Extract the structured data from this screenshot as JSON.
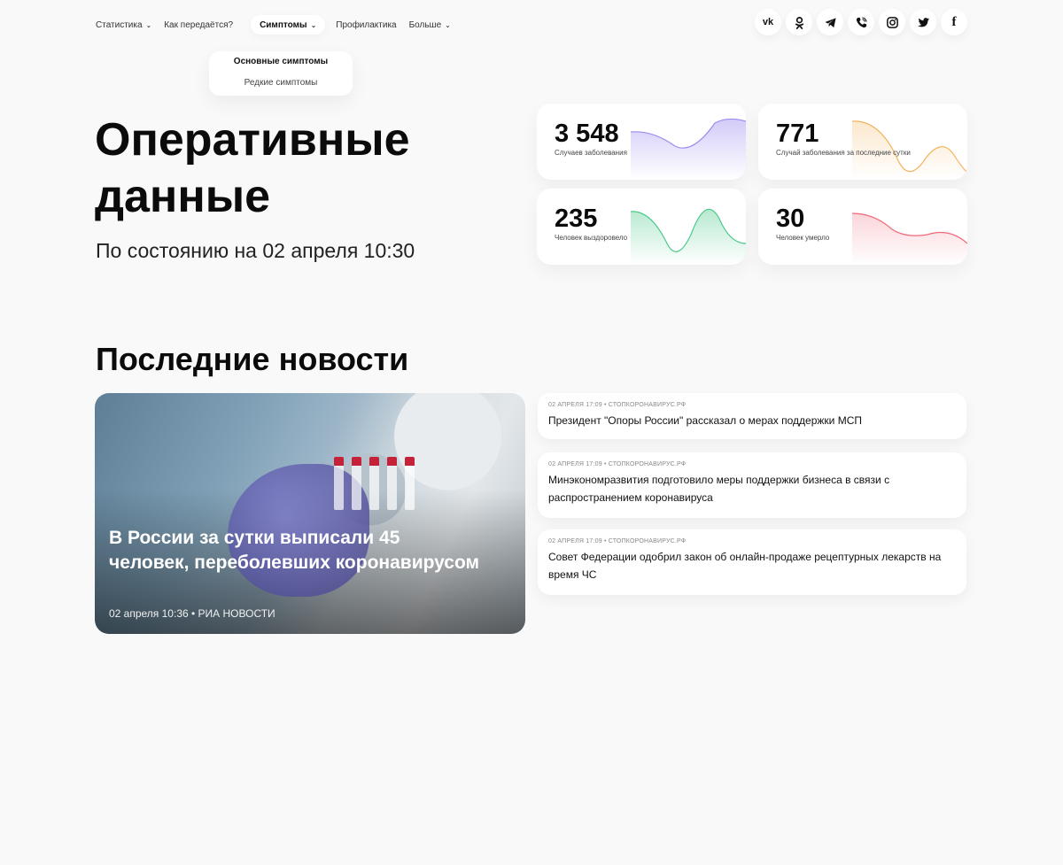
{
  "nav": {
    "items": [
      {
        "label": "Статистика",
        "dropdown": true
      },
      {
        "label": "Как передаётся?",
        "dropdown": false
      },
      {
        "label": "Симптомы",
        "dropdown": true,
        "active": true
      },
      {
        "label": "Профилактика",
        "dropdown": false
      },
      {
        "label": "Больше",
        "dropdown": true
      }
    ],
    "dropdown": {
      "items": [
        "Основные симптомы",
        "Редкие симптомы"
      ]
    }
  },
  "social": {
    "icons": [
      "vk-icon",
      "odnoklassniki-icon",
      "telegram-icon",
      "viber-icon",
      "instagram-icon",
      "twitter-icon",
      "facebook-icon"
    ],
    "vk_label": "vk",
    "facebook_label": "f"
  },
  "hero": {
    "title": "Оперативные данные",
    "subtitle": "По состоянию на 02 апреля 10:30"
  },
  "stats": [
    {
      "value": "3 548",
      "label": "Случаев заболевания",
      "color": "#9b8cf0"
    },
    {
      "value": "771",
      "label": "Случай заболевания за последние сутки",
      "color": "#f3b35c"
    },
    {
      "value": "235",
      "label": "Человек выздоровело",
      "color": "#4cc98a"
    },
    {
      "value": "30",
      "label": "Человек умерло",
      "color": "#ee6a7a"
    }
  ],
  "news": {
    "section_title": "Последние новости",
    "featured": {
      "title": "В России за сутки выписали 45 человек, переболевших коронавирусом",
      "meta": "02 апреля 10:36 • РИА НОВОСТИ"
    },
    "items": [
      {
        "meta": "02 апреля 17:09 • стопкоронавирус.рф",
        "title": "Президент \"Опоры России\" рассказал о мерах поддержки МСП"
      },
      {
        "meta": "02 апреля 17:09 • стопкоронавирус.рф",
        "title": "Минэкономразвития подготовило меры поддержки бизнеса в связи с распространением коронавируса"
      },
      {
        "meta": "02 апреля 17:09 • стопкоронавирус.рф",
        "title": "Совет Федерации одобрил закон об онлайн-продаже рецептурных лекарств на время ЧС"
      }
    ]
  }
}
